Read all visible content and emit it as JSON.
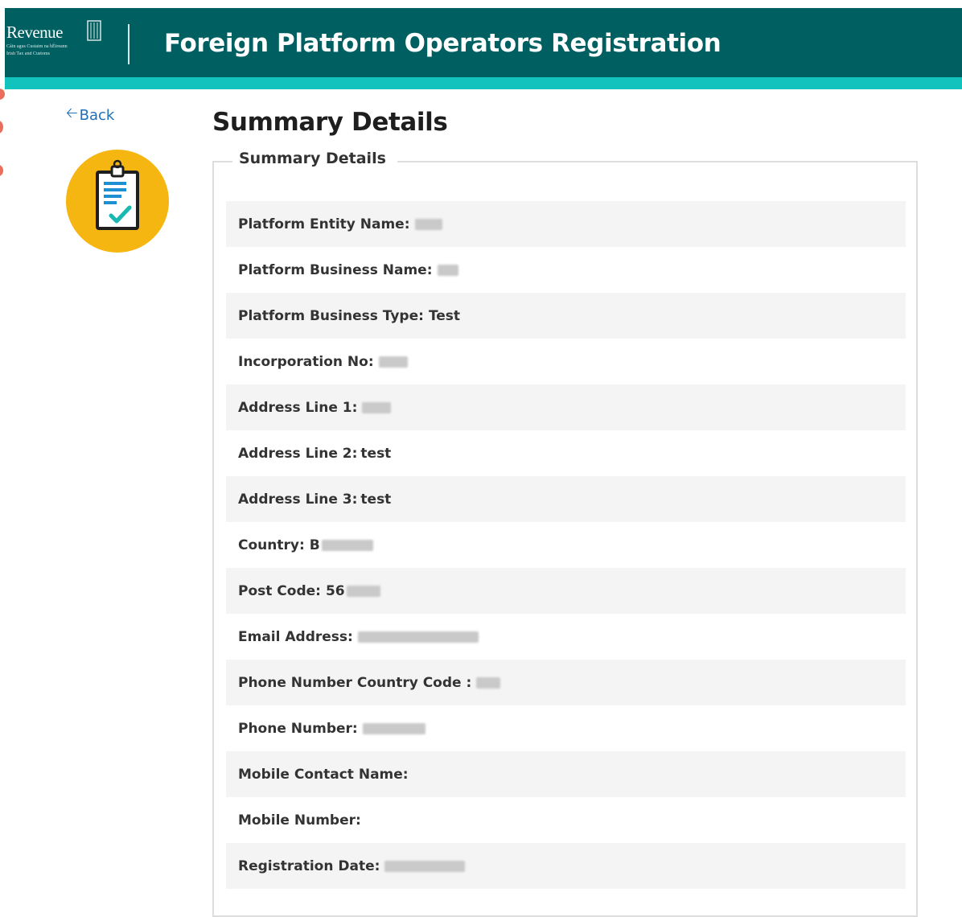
{
  "header": {
    "logo_text": "Revenue",
    "logo_subtext_1": "Cáin agus Custaim na hÉireann",
    "logo_subtext_2": "Irish Tax and Customs",
    "title": "Foreign Platform Operators Registration"
  },
  "nav": {
    "back_label": "Back"
  },
  "page": {
    "title": "Summary Details",
    "section_legend": "Summary Details"
  },
  "rows": [
    {
      "label": "Platform Entity Name:",
      "value": ""
    },
    {
      "label": "Platform Business Name:",
      "value": ""
    },
    {
      "label": "Platform Business Type:",
      "value": "Test"
    },
    {
      "label": "Incorporation No:",
      "value": ""
    },
    {
      "label": "Address Line 1:",
      "value": ""
    },
    {
      "label": "Address Line 2:",
      "value": "test"
    },
    {
      "label": "Address Line 3:",
      "value": "test"
    },
    {
      "label": "Country:",
      "value": "B"
    },
    {
      "label": "Post Code:",
      "value": "56"
    },
    {
      "label": "Email Address:",
      "value": ""
    },
    {
      "label": "Phone Number Country Code :",
      "value": ""
    },
    {
      "label": "Phone Number:",
      "value": ""
    },
    {
      "label": "Mobile Contact Name:",
      "value": ""
    },
    {
      "label": "Mobile Number:",
      "value": ""
    },
    {
      "label": "Registration Date:",
      "value": ""
    }
  ],
  "icons": {
    "back": "arrow-left-icon",
    "summary": "clipboard-check-icon",
    "logo": "harp-icon"
  },
  "colors": {
    "header_bg": "#005f61",
    "header_band": "#12c2bd",
    "icon_circle": "#f6b611",
    "link": "#1f6fb5",
    "row_alt": "#f4f4f4"
  }
}
